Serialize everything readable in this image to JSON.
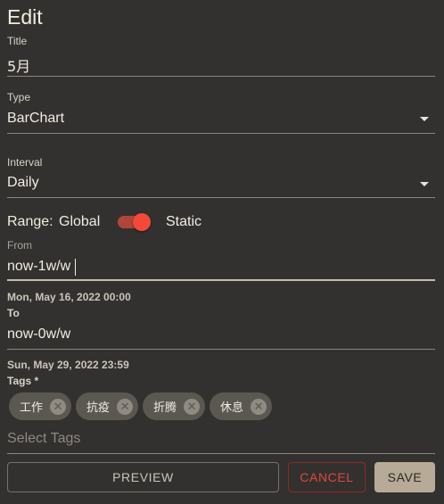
{
  "dialog": {
    "title": "Edit"
  },
  "title_field": {
    "label": "Title",
    "value": "5月"
  },
  "type_field": {
    "label": "Type",
    "value": "BarChart"
  },
  "interval_field": {
    "label": "Interval",
    "value": "Daily"
  },
  "range": {
    "label": "Range:",
    "left_option": "Global",
    "right_option": "Static",
    "static_on": true
  },
  "from_field": {
    "label": "From",
    "value": "now-1w/w",
    "helper": "Mon, May 16, 2022 00:00"
  },
  "to_field": {
    "label": "To",
    "value": "now-0w/w",
    "helper": "Sun, May 29, 2022 23:59"
  },
  "tags": {
    "label": "Tags *",
    "chips": [
      "工作",
      "抗疫",
      "折腾",
      "休息"
    ],
    "placeholder": "Select Tags"
  },
  "actions": {
    "preview": "PREVIEW",
    "cancel": "CANCEL",
    "save": "SAVE"
  },
  "colors": {
    "background": "#33312f",
    "toggle": "#f4493a",
    "cancel": "#e2463a",
    "save_bg": "#b7aa96"
  }
}
